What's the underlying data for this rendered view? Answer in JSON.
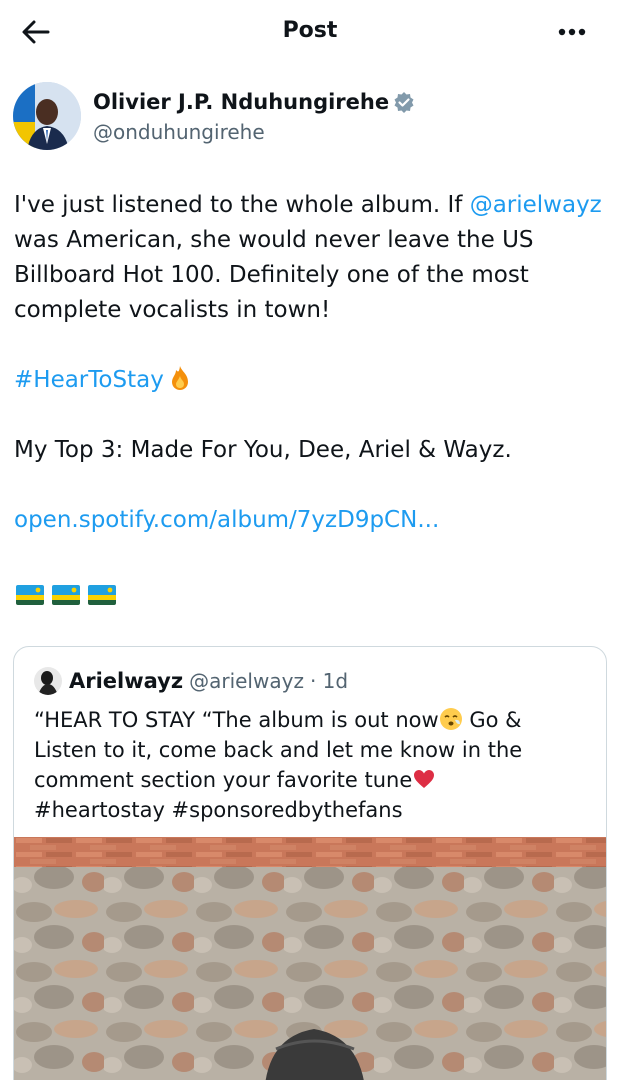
{
  "header": {
    "title": "Post",
    "back_icon": "arrow-left-icon",
    "more_icon": "more-horizontal-icon"
  },
  "author": {
    "name": "Olivier J.P. Nduhungirehe",
    "handle": "@onduhungirehe",
    "verified": true
  },
  "post": {
    "line1_text": "I've just listened to the whole album. If ",
    "mention": "@arielwayz",
    "line2": "was American, she would never leave the US",
    "line3": "Billboard Hot 100. Definitely one of the most",
    "line4": "complete vocalists in town!",
    "hashtag": "#HearToStay",
    "top3": "My Top 3: Made For You, Dee, Ariel & Wayz.",
    "link": "open.spotify.com/album/7yzD9pCN...",
    "flag_count": 3
  },
  "quoted": {
    "name": "Arielwayz",
    "handle": "@arielwayz",
    "time": "· 1d",
    "line1_a": "“HEAR TO STAY “The album is out now",
    "line1_b": " Go &",
    "line2": "Listen to it,  come back and let me know in the",
    "line3": "comment section your favorite tune",
    "line4": "#heartostay #sponsoredbythefans"
  },
  "colors": {
    "link": "#1d9bf0",
    "text": "#0f1419",
    "secondary": "#536471",
    "border": "#cfd9de"
  }
}
